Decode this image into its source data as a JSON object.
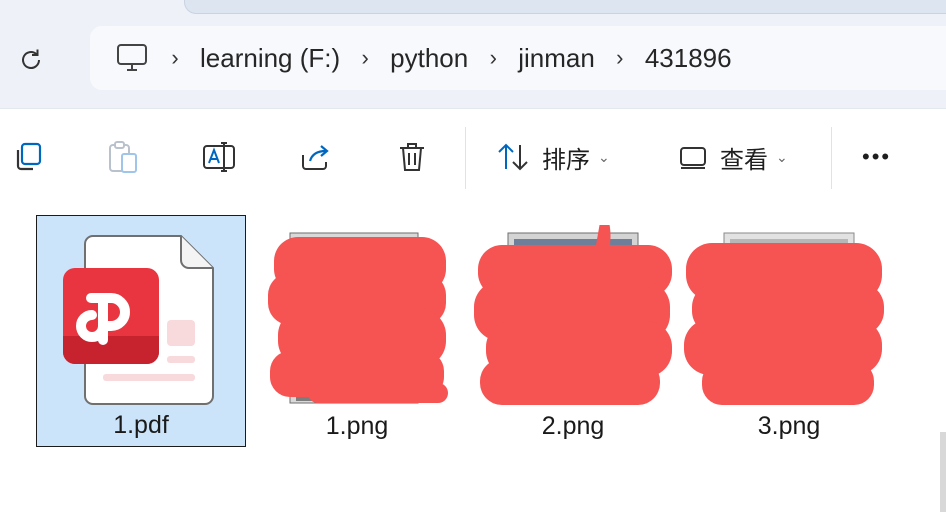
{
  "address_bar": {
    "crumbs": [
      "learning (F:)",
      "python",
      "jinman",
      "431896"
    ],
    "separator": "›"
  },
  "toolbar": {
    "sort_label": "排序",
    "view_label": "查看",
    "more_label": "•••",
    "buttons": [
      "copy",
      "paste",
      "rename",
      "share",
      "delete",
      "sort",
      "view",
      "more"
    ]
  },
  "files": [
    {
      "name": "1.pdf",
      "type": "pdf",
      "selected": true
    },
    {
      "name": "1.png",
      "type": "png",
      "selected": false
    },
    {
      "name": "2.png",
      "type": "png",
      "selected": false
    },
    {
      "name": "3.png",
      "type": "png",
      "selected": false
    }
  ],
  "colors": {
    "accent": "#0067c0",
    "selection": "#cce4fa",
    "redaction": "#f65353",
    "pdf_red": "#e8353f"
  }
}
